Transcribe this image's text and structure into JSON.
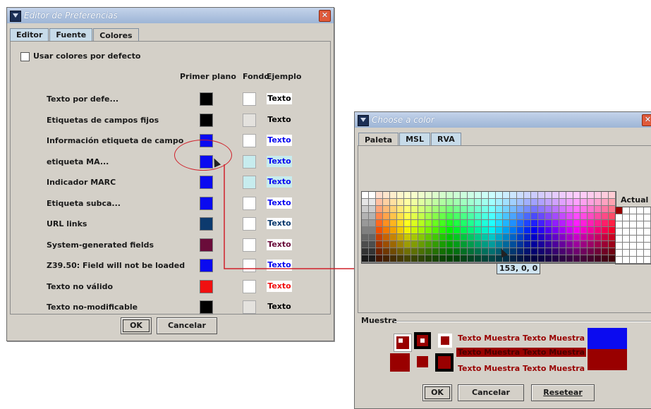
{
  "prefs": {
    "title": "Editor de Preferencias",
    "tabs": [
      "Editor",
      "Fuente",
      "Colores"
    ],
    "use_default_colors": "Usar colores por defecto",
    "headers": {
      "fg": "Primer plano",
      "bg": "Fondo",
      "example": "Ejemplo"
    },
    "rows": [
      {
        "label": "Texto por defe...",
        "fg": "#000000",
        "bg": "#ffffff",
        "example": "Texto",
        "ex_color": "#000000",
        "ex_bg": "#ffffff"
      },
      {
        "label": "Etiquetas de campos fijos",
        "fg": "#000000",
        "bg": "#e4e2de",
        "example": "Texto",
        "ex_color": "#000000",
        "ex_bg": "#d4d0c8"
      },
      {
        "label": "Información etiqueta de campo",
        "fg": "#0a0af0",
        "bg": "#ffffff",
        "example": "Texto",
        "ex_color": "#0a0af0",
        "ex_bg": "#ffffff"
      },
      {
        "label": "etiqueta MA...",
        "fg": "#0a0af0",
        "bg": "#c7ecee",
        "example": "Texto",
        "ex_color": "#0a0af0",
        "ex_bg": "#c7ecee"
      },
      {
        "label": "Indicador MARC",
        "fg": "#0a0af0",
        "bg": "#c7ecee",
        "example": "Texto",
        "ex_color": "#0a0af0",
        "ex_bg": "#c7ecee"
      },
      {
        "label": "Etiqueta subca...",
        "fg": "#0a0af0",
        "bg": "#ffffff",
        "example": "Texto",
        "ex_color": "#0a0af0",
        "ex_bg": "#ffffff"
      },
      {
        "label": "URL links",
        "fg": "#0c3a6e",
        "bg": "#ffffff",
        "example": "Texto",
        "ex_color": "#0c3a6e",
        "ex_bg": "#ffffff"
      },
      {
        "label": "System-generated fields",
        "fg": "#6a0c3a",
        "bg": "#ffffff",
        "example": "Texto",
        "ex_color": "#6a0c3a",
        "ex_bg": "#ffffff"
      },
      {
        "label": "Z39.50: Field will not be loaded",
        "fg": "#0a0af0",
        "bg": "#ffffff",
        "example": "Texto",
        "ex_color": "#0a0af0",
        "ex_bg": "#ffffff"
      },
      {
        "label": "Texto no válido",
        "fg": "#f01010",
        "bg": "#ffffff",
        "example": "Texto",
        "ex_color": "#f01010",
        "ex_bg": "#ffffff"
      },
      {
        "label": "Texto no-modificable",
        "fg": "#000000",
        "bg": "#e4e2de",
        "example": "Texto",
        "ex_color": "#000000",
        "ex_bg": "#d4d0c8"
      }
    ],
    "ok": "OK",
    "cancel": "Cancelar"
  },
  "chooser": {
    "title": "Choose a color",
    "tabs": [
      "Paleta",
      "MSL",
      "RVA"
    ],
    "recent_label": "Actual",
    "tooltip": "153, 0, 0",
    "sample_label": "Muestra",
    "sample_text": "Texto Muestra Texto Muestra",
    "sample_color": "#990000",
    "sample_top_right": "#0b0bf0",
    "ok": "OK",
    "cancel": "Cancelar",
    "reset": "Resetear"
  },
  "annotation_color": "#d0202a"
}
